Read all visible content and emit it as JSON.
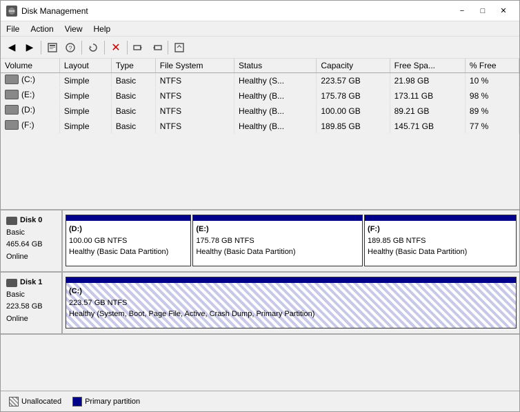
{
  "window": {
    "title": "Disk Management",
    "icon": "disk-icon"
  },
  "menus": {
    "items": [
      "File",
      "Action",
      "View",
      "Help"
    ]
  },
  "toolbar": {
    "buttons": [
      {
        "name": "back",
        "icon": "◀"
      },
      {
        "name": "forward",
        "icon": "▶"
      },
      {
        "name": "properties",
        "icon": "📋"
      },
      {
        "name": "help",
        "icon": "❓"
      },
      {
        "name": "refresh",
        "icon": "🔄"
      },
      {
        "name": "delete",
        "icon": "✖"
      },
      {
        "name": "extend",
        "icon": "📊"
      },
      {
        "name": "shrink",
        "icon": "📉"
      },
      {
        "name": "format",
        "icon": "💾"
      }
    ]
  },
  "table": {
    "columns": [
      "Volume",
      "Layout",
      "Type",
      "File System",
      "Status",
      "Capacity",
      "Free Spa...",
      "% Free"
    ],
    "rows": [
      {
        "volume": "(C:)",
        "layout": "Simple",
        "type": "Basic",
        "fs": "NTFS",
        "status": "Healthy (S...",
        "capacity": "223.57 GB",
        "free": "21.98 GB",
        "pct": "10 %",
        "hasIcon": true
      },
      {
        "volume": "(E:)",
        "layout": "Simple",
        "type": "Basic",
        "fs": "NTFS",
        "status": "Healthy (B...",
        "capacity": "175.78 GB",
        "free": "173.11 GB",
        "pct": "98 %",
        "hasIcon": true
      },
      {
        "volume": "(D:)",
        "layout": "Simple",
        "type": "Basic",
        "fs": "NTFS",
        "status": "Healthy (B...",
        "capacity": "100.00 GB",
        "free": "89.21 GB",
        "pct": "89 %",
        "hasIcon": true
      },
      {
        "volume": "(F:)",
        "layout": "Simple",
        "type": "Basic",
        "fs": "NTFS",
        "status": "Healthy (B...",
        "capacity": "189.85 GB",
        "free": "145.71 GB",
        "pct": "77 %",
        "hasIcon": true
      }
    ]
  },
  "disks": [
    {
      "name": "Disk 0",
      "type": "Basic",
      "size": "465.64 GB",
      "status": "Online",
      "partitions": [
        {
          "label": "(D:)",
          "size": "100.00 GB NTFS",
          "status": "Healthy (Basic Data Partition)",
          "widthPct": 28,
          "type": "primary"
        },
        {
          "label": "(E:)",
          "size": "175.78 GB NTFS",
          "status": "Healthy (Basic Data Partition)",
          "widthPct": 38,
          "type": "primary"
        },
        {
          "label": "(F:)",
          "size": "189.85 GB NTFS",
          "status": "Healthy (Basic Data Partition)",
          "widthPct": 34,
          "type": "primary"
        }
      ]
    },
    {
      "name": "Disk 1",
      "type": "Basic",
      "size": "223.58 GB",
      "status": "Online",
      "partitions": [
        {
          "label": "(C:)",
          "size": "223.57 GB NTFS",
          "status": "Healthy (System, Boot, Page File, Active, Crash Dump, Primary Partition)",
          "widthPct": 100,
          "type": "primary"
        }
      ]
    }
  ],
  "legend": {
    "items": [
      {
        "type": "unallocated",
        "label": "Unallocated"
      },
      {
        "type": "primary",
        "label": "Primary partition"
      }
    ]
  }
}
